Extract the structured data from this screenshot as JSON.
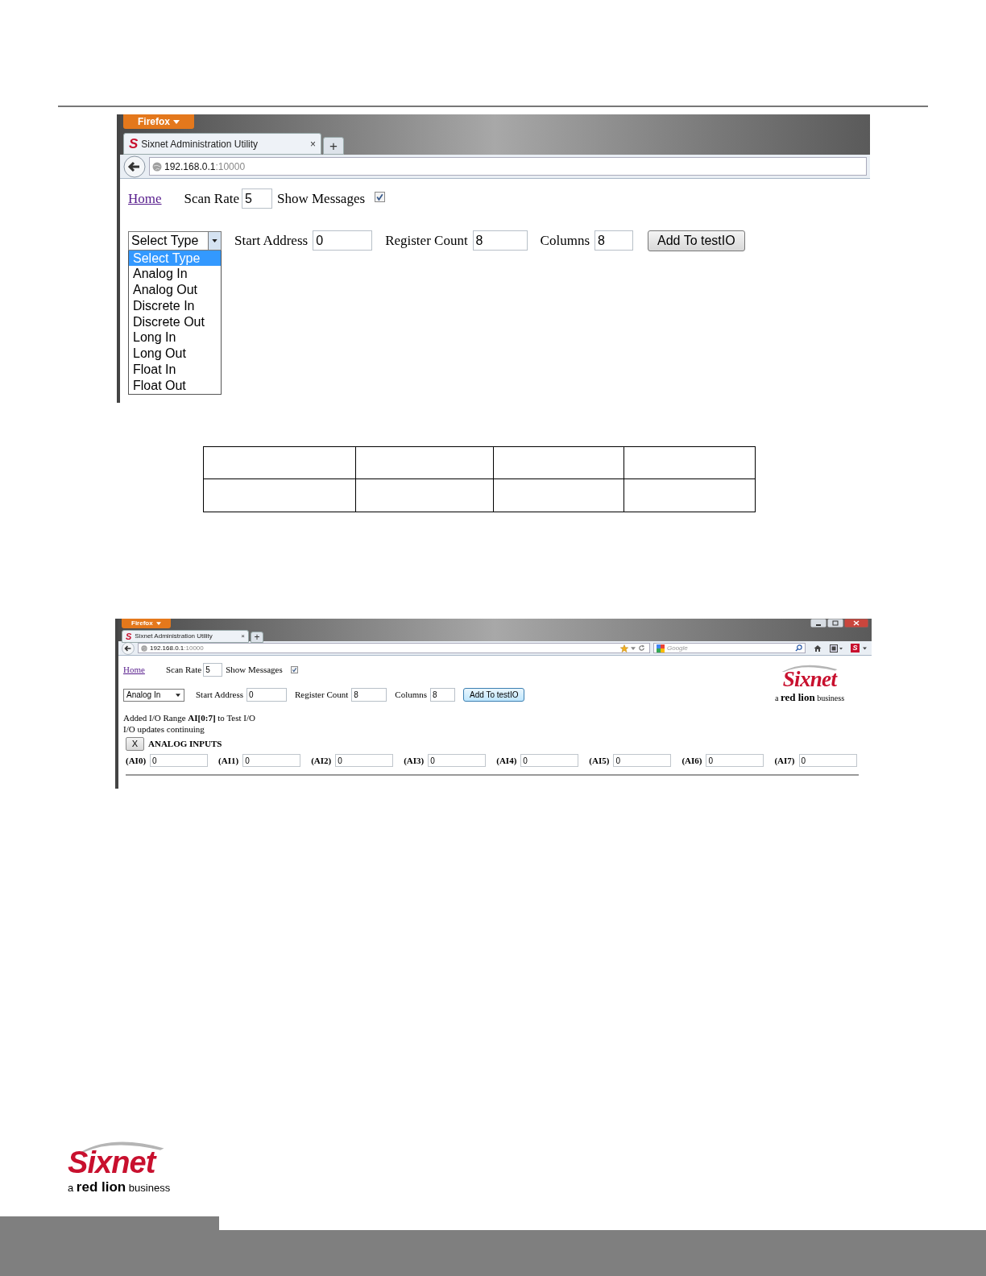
{
  "screenshot_1": {
    "browser_menu": "Firefox",
    "tab": {
      "favicon": "S",
      "title": "Sixnet Administration Utility",
      "close": "×"
    },
    "new_tab": "+",
    "address": {
      "host": "192.168.0.1",
      "port": ":10000"
    },
    "home_link": "Home",
    "scan_rate_label": "Scan Rate",
    "scan_rate": "5",
    "show_messages_label": "Show Messages",
    "show_messages": true,
    "type_select": "Select Type",
    "start_address_label": "Start Address",
    "start_address": "0",
    "register_count_label": "Register Count",
    "register_count": "8",
    "columns_label": "Columns",
    "columns": "8",
    "add_button": "Add To testIO",
    "dropdown_options": [
      {
        "label": "Select Type",
        "selected": true
      },
      {
        "label": "Analog In",
        "selected": false
      },
      {
        "label": "Analog Out",
        "selected": false
      },
      {
        "label": "Discrete In",
        "selected": false
      },
      {
        "label": "Discrete Out",
        "selected": false
      },
      {
        "label": "Long In",
        "selected": false
      },
      {
        "label": "Long Out",
        "selected": false
      },
      {
        "label": "Float In",
        "selected": false
      },
      {
        "label": "Float Out",
        "selected": false
      }
    ]
  },
  "screenshot_2": {
    "browser_menu": "Firefox",
    "tab": {
      "favicon": "S",
      "title": "Sixnet Administration Utility",
      "close": "×"
    },
    "new_tab": "+",
    "address": {
      "host": "192.168.0.1",
      "port": ":10000"
    },
    "search_placeholder": "Google",
    "toolbar_badge": "S",
    "home_link": "Home",
    "scan_rate_label": "Scan Rate",
    "scan_rate": "5",
    "show_messages_label": "Show Messages",
    "show_messages": true,
    "type_select": "Analog In",
    "start_address_label": "Start Address",
    "start_address": "0",
    "register_count_label": "Register Count",
    "register_count": "8",
    "columns_label": "Columns",
    "columns": "8",
    "add_button": "Add To testIO",
    "logo": {
      "name": "Sixnet",
      "prefix": "a",
      "brand": "red lion",
      "suffix": "business"
    },
    "messages": [
      "Added I/O Range **AI[0:7]** to Test I/O",
      "I/O updates continuing"
    ],
    "section": {
      "close": "X",
      "title": "ANALOG INPUTS",
      "inputs": [
        {
          "label": "(AI0)",
          "value": "0"
        },
        {
          "label": "(AI1)",
          "value": "0"
        },
        {
          "label": "(AI2)",
          "value": "0"
        },
        {
          "label": "(AI3)",
          "value": "0"
        },
        {
          "label": "(AI4)",
          "value": "0"
        },
        {
          "label": "(AI5)",
          "value": "0"
        },
        {
          "label": "(AI6)",
          "value": "0"
        },
        {
          "label": "(AI7)",
          "value": "0"
        }
      ]
    }
  },
  "footer_logo": {
    "name": "Sixnet",
    "prefix": "a",
    "brand": "red lion",
    "suffix": "business"
  }
}
